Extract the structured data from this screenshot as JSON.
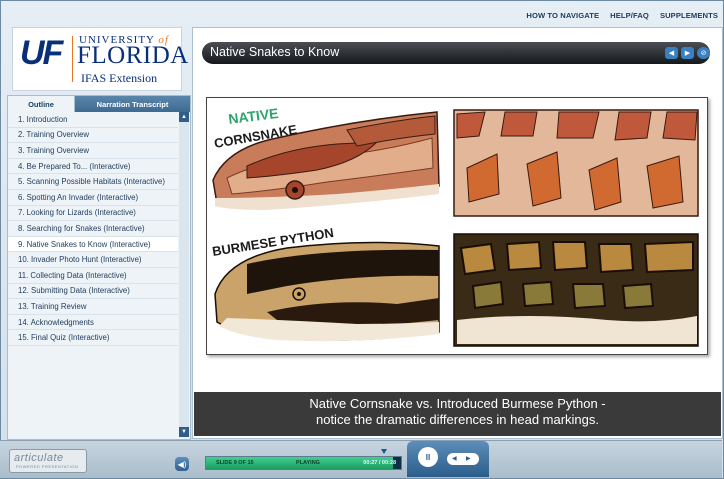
{
  "header": {
    "links": [
      "HOW TO NAVIGATE",
      "HELP/FAQ",
      "SUPPLEMENTS"
    ]
  },
  "logo": {
    "mark": "UF",
    "university": "UNIVERSITY",
    "of": "of",
    "state": "FLORIDA",
    "unit": "IFAS Extension"
  },
  "sidebar": {
    "tabs": [
      "Outline",
      "Narration Transcript"
    ],
    "items": [
      "1. Introduction",
      "2. Training Overview",
      "3. Training Overview",
      "4. Be Prepared To... (Interactive)",
      "5. Scanning Possible Habitats (Interactive)",
      "6. Spotting An Invader (Interactive)",
      "7. Looking for Lizards (Interactive)",
      "8. Searching for Snakes (Interactive)",
      "9. Native Snakes to Know (Interactive)",
      "10. Invader Photo Hunt (Interactive)",
      "11. Collecting Data (Interactive)",
      "12. Submitting Data (Interactive)",
      "13. Training Review",
      "14. Acknowledgments",
      "15. Final Quiz (Interactive)"
    ],
    "selected_index": 8
  },
  "main": {
    "title": "Native Snakes to Know",
    "slide": {
      "label_native": "NATIVE",
      "label_cornsnake": "CORNSNAKE",
      "label_python": "BURMESE PYTHON"
    },
    "caption_line1": "Native Cornsnake vs. Introduced Burmese Python -",
    "caption_line2": "notice the dramatic differences in head markings."
  },
  "player": {
    "brand": "articulate",
    "brand_sub": "POWERED PRESENTATION",
    "slide_label": "SLIDE 9 OF 15",
    "status": "PLAYING",
    "time": "00:27 / 00:28",
    "progress": 0.96
  },
  "colors": {
    "accent": "#2f6090",
    "title_bar": "#15181b",
    "progress_fill": "#2fbf7a",
    "native_label": "#2fa36b",
    "snake_label": "#1b1b1b"
  }
}
